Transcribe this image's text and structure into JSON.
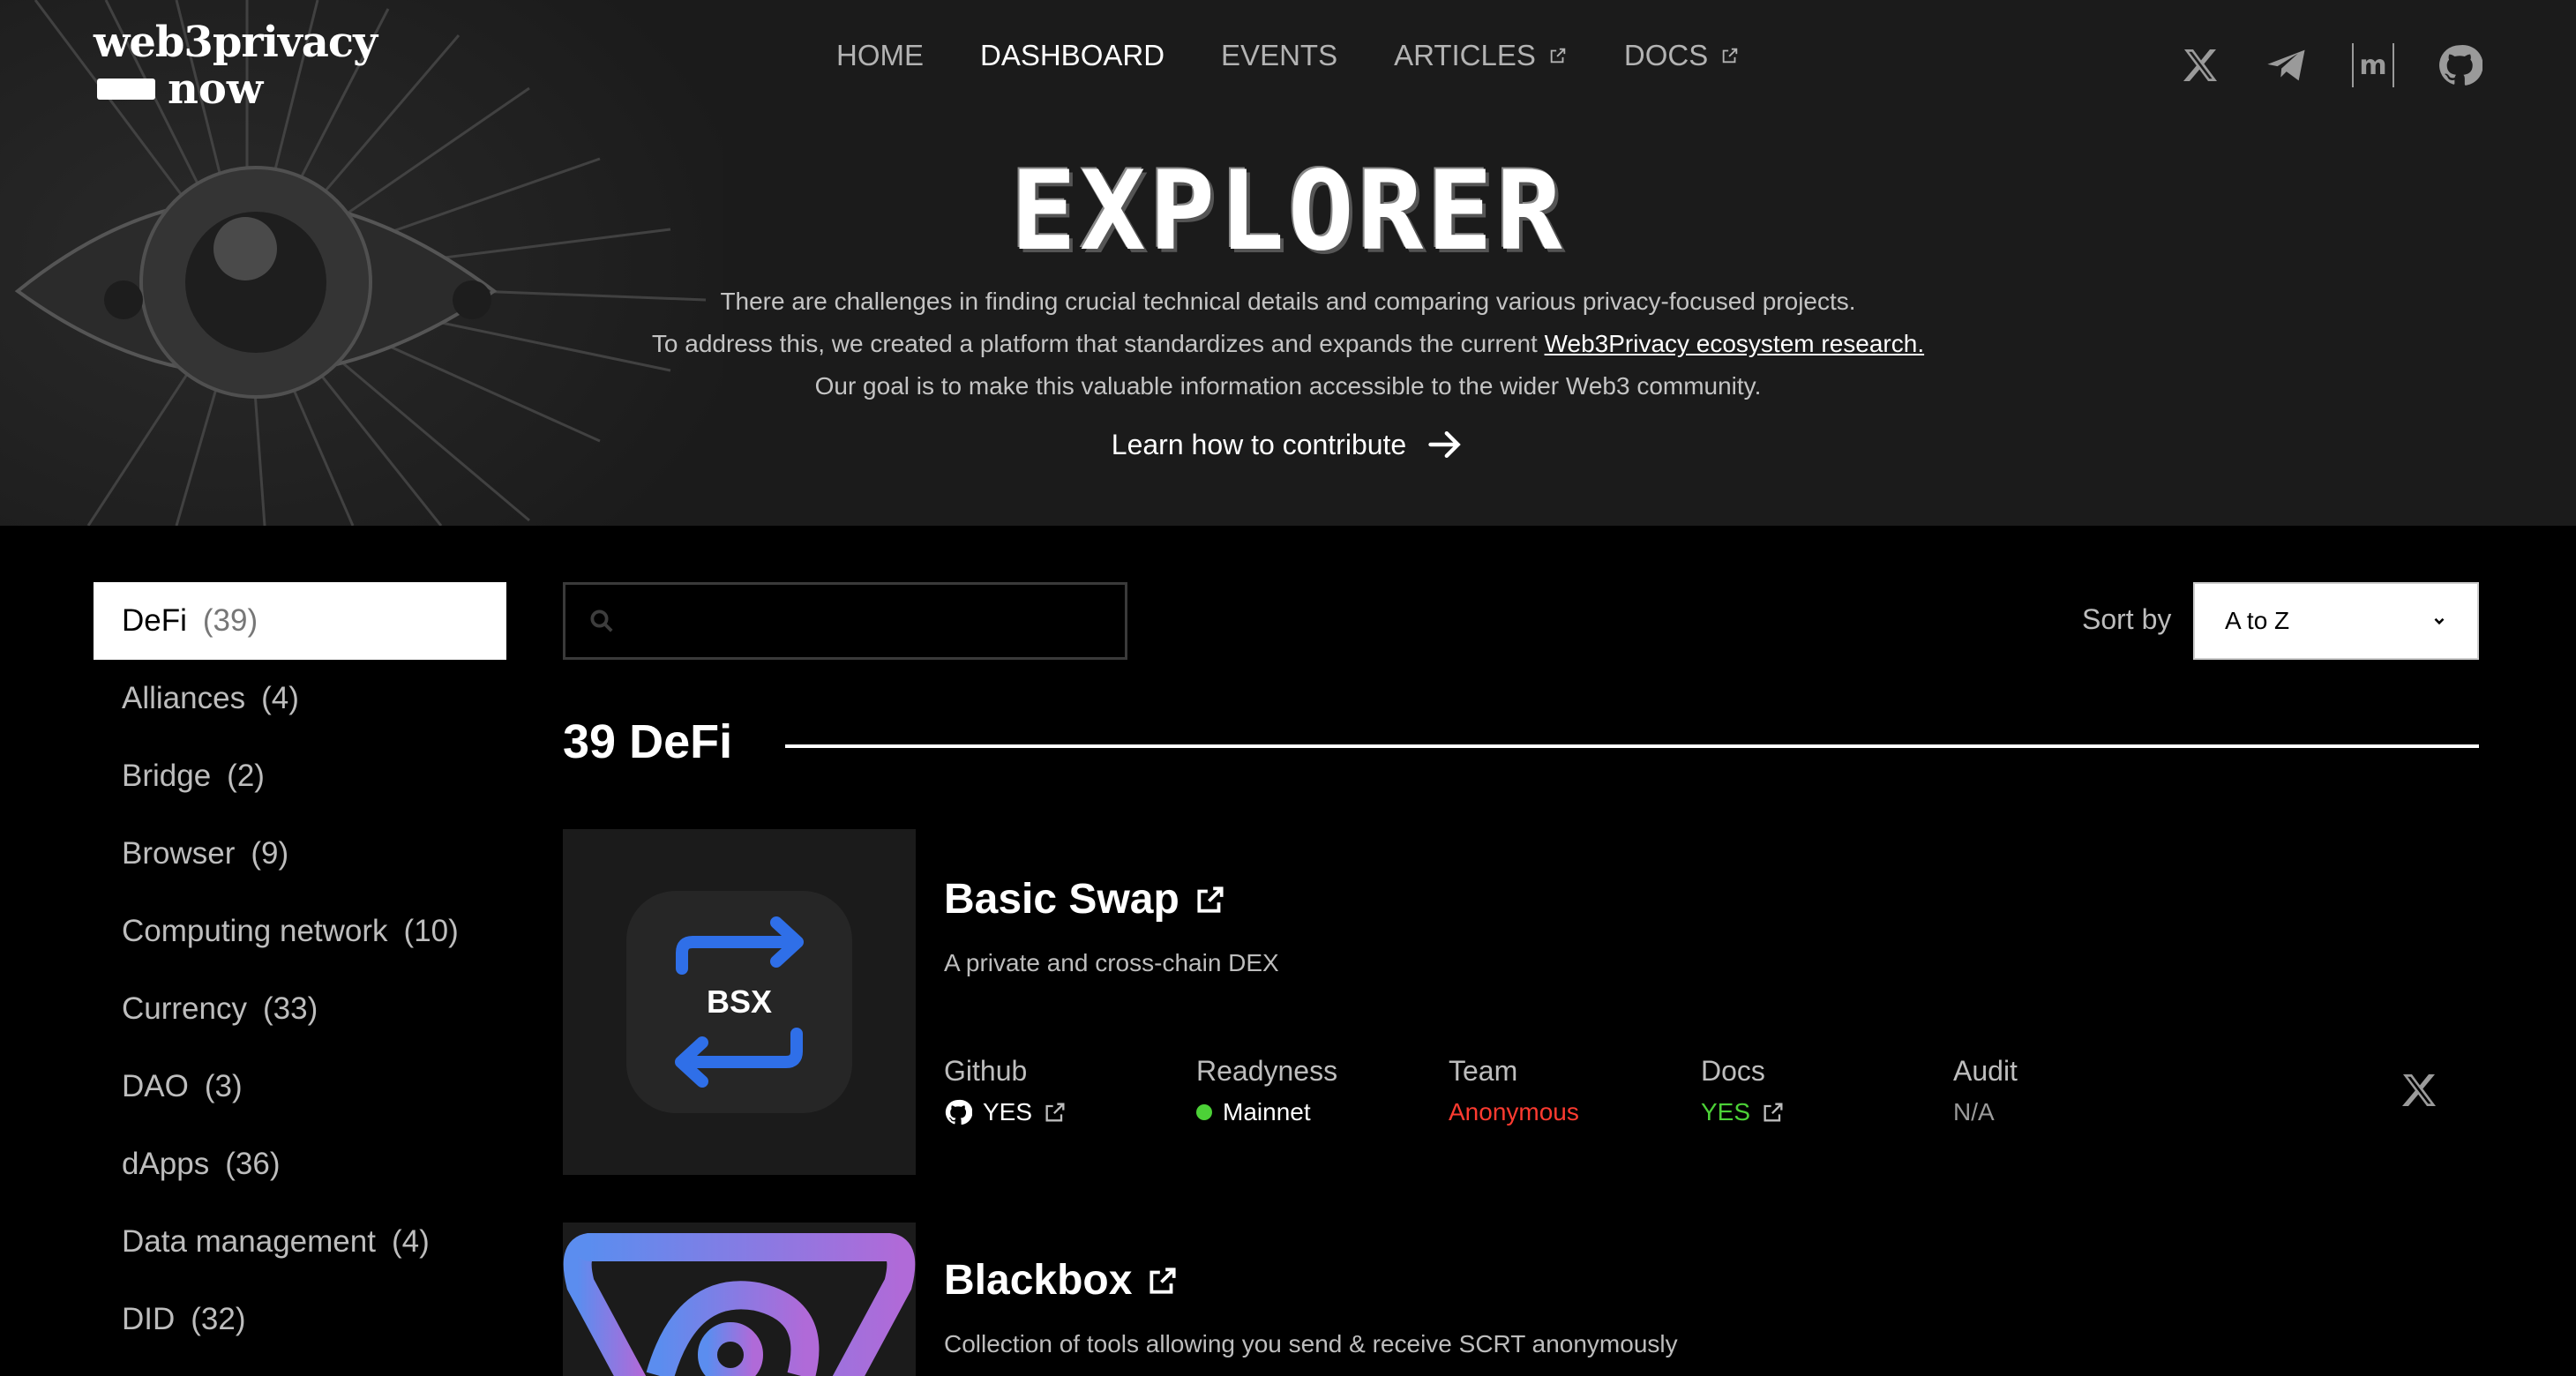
{
  "logo": {
    "line1": "web3privacy",
    "line2": "now"
  },
  "nav": [
    {
      "label": "HOME",
      "external": false,
      "active": false
    },
    {
      "label": "DASHBOARD",
      "external": false,
      "active": true
    },
    {
      "label": "EVENTS",
      "external": false,
      "active": false
    },
    {
      "label": "ARTICLES",
      "external": true,
      "active": false
    },
    {
      "label": "DOCS",
      "external": true,
      "active": false
    }
  ],
  "socials": [
    "x-icon",
    "telegram-icon",
    "matrix-icon",
    "github-icon"
  ],
  "hero": {
    "title": "EXPLORER",
    "line1": "There are challenges in finding crucial technical details and comparing various privacy-focused projects.",
    "line2_prefix": "To address this, we created a platform that standardizes and expands the current ",
    "line2_link": "Web3Privacy ecosystem research.",
    "line3": "Our goal is to make this valuable information accessible to the wider Web3 community.",
    "contribute": "Learn how to contribute"
  },
  "categories": [
    {
      "label": "DeFi",
      "count": "(39)",
      "active": true
    },
    {
      "label": "Alliances",
      "count": "(4)"
    },
    {
      "label": "Bridge",
      "count": "(2)"
    },
    {
      "label": "Browser",
      "count": "(9)"
    },
    {
      "label": "Computing network",
      "count": "(10)"
    },
    {
      "label": "Currency",
      "count": "(33)"
    },
    {
      "label": "DAO",
      "count": "(3)"
    },
    {
      "label": "dApps",
      "count": "(36)"
    },
    {
      "label": "Data management",
      "count": "(4)"
    },
    {
      "label": "DID",
      "count": "(32)"
    }
  ],
  "search": {
    "placeholder": "",
    "value": ""
  },
  "sort": {
    "label": "Sort by",
    "value": "A to Z"
  },
  "section": {
    "title": "39 DeFi"
  },
  "meta_headers": {
    "github": "Github",
    "readyness": "Readyness",
    "team": "Team",
    "docs": "Docs",
    "audit": "Audit"
  },
  "projects": [
    {
      "name": "Basic Swap",
      "logo_text": "BSX",
      "description": "A private and cross-chain DEX",
      "github": "YES",
      "readyness": "Mainnet",
      "team": "Anonymous",
      "docs": "YES",
      "audit": "N/A"
    },
    {
      "name": "Blackbox",
      "description": "Collection of tools allowing you send & receive SCRT anonymously"
    }
  ],
  "colors": {
    "background": "#000000",
    "hero_bg": "#1b1b1b",
    "accent_blue": "#2f6fe8",
    "team_red": "#ff3b30",
    "docs_green": "#4cd137",
    "mainnet_dot": "#4cd137"
  }
}
